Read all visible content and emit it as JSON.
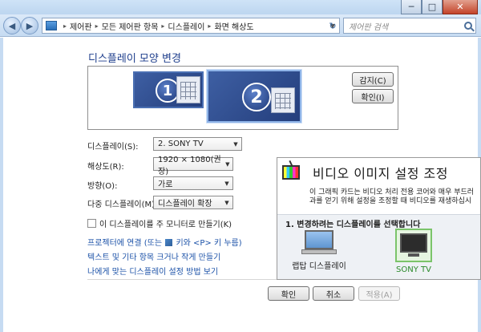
{
  "window": {
    "controls": {
      "minimize": "─",
      "maximize": "□",
      "close": "✕"
    }
  },
  "nav": {
    "back": "◀",
    "forward": "▶",
    "breadcrumbs": [
      "제어판",
      "모든 제어판 항목",
      "디스플레이",
      "화면 해상도"
    ],
    "separator": "▸",
    "dropdown": "▼",
    "refresh": "↻",
    "search_placeholder": "제어판 검색"
  },
  "main": {
    "heading": "디스플레이 모양 변경",
    "monitors": [
      {
        "number": "1"
      },
      {
        "number": "2"
      }
    ],
    "detect_label": "감지(C)",
    "identify_label": "확인(I)",
    "fields": {
      "display": {
        "label": "디스플레이(S):",
        "value": "2. SONY TV"
      },
      "resolution": {
        "label": "해상도(R):",
        "value": "1920 × 1080(권장)"
      },
      "orientation": {
        "label": "방향(O):",
        "value": "가로"
      },
      "multiple": {
        "label": "다중 디스플레이(M):",
        "value": "디스플레이 확장"
      }
    },
    "main_monitor_checkbox": {
      "label": "이 디스플레이를 주 모니터로 만들기(K)",
      "checked": false
    },
    "links": {
      "projector_pre": "프로젝터에 연결 (또는",
      "projector_post": "키와 <P> 키 누름)",
      "text_size": "텍스트 및 기타 항목 크거나 작게 만들기",
      "help": "나에게 맞는 디스플레이 설정 방법 보기"
    },
    "buttons": {
      "ok": "확인",
      "cancel": "취소",
      "apply": "적용(A)"
    }
  },
  "popup": {
    "title": "비디오 이미지 설정 조정",
    "desc_line1": "이 그래픽 카드는 비디오 처리 전용 코어와 매우 부드러",
    "desc_line2": "과를 얻기 위해 설정을 조정할 때 비디오를 재생하십시",
    "section": "1. 변경하려는 디스플레이를 선택합니다",
    "devices": [
      {
        "name": "랩탑 디스플레이"
      },
      {
        "name": "SONY TV"
      }
    ]
  },
  "colors": {
    "heading": "#1e3e8c",
    "link": "#1c52a8",
    "selected_device": "#2a8a2a"
  }
}
